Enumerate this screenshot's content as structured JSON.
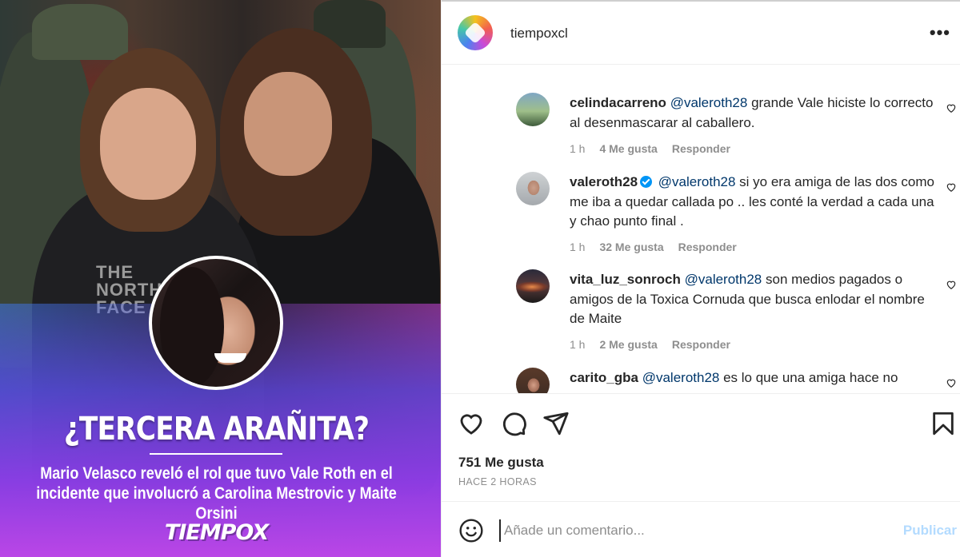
{
  "post": {
    "brand_headline": "¿TERCERA ARAÑITA?",
    "brand_subhead": "Mario Velasco reveló el rol que tuvo Vale Roth en el incidente que involucró a Carolina Mestrovic y Maite Orsini",
    "brand_logo": "TIEMPOX",
    "hoodie_text": "THE NORTH FACE"
  },
  "header": {
    "username": "tiempoxcl",
    "more_label": "•••"
  },
  "comments": [
    {
      "username": "celindacarreno",
      "mention": "@valeroth28",
      "text": " grande Vale hiciste lo correcto al desenmascarar al caballero.",
      "time": "1 h",
      "likes": "4 Me gusta",
      "reply": "Responder",
      "verified": false
    },
    {
      "username": "valeroth28",
      "mention": "@valeroth28",
      "text": " si yo era amiga de las dos como me iba a quedar callada po .. les conté la verdad a cada una y chao punto final .",
      "time": "1 h",
      "likes": "32 Me gusta",
      "reply": "Responder",
      "verified": true
    },
    {
      "username": "vita_luz_sonroch",
      "mention": "@valeroth28",
      "text": " son medios pagados o amigos de la Toxica Cornuda que busca enlodar el nombre de Maite",
      "time": "1 h",
      "likes": "2 Me gusta",
      "reply": "Responder",
      "verified": false
    },
    {
      "username": "carito_gba",
      "mention": "@valeroth28",
      "text": " es lo que una amiga hace no",
      "verified": false
    }
  ],
  "actions": {
    "likes_count": "751 Me gusta",
    "time_ago": "HACE 2 HORAS"
  },
  "composer": {
    "placeholder": "Añade un comentario...",
    "publish_label": "Publicar"
  },
  "colors": {
    "accent": "#0095f6",
    "mention": "#00376b",
    "muted": "#8e8e8e",
    "publish_disabled": "#b3dbff"
  }
}
